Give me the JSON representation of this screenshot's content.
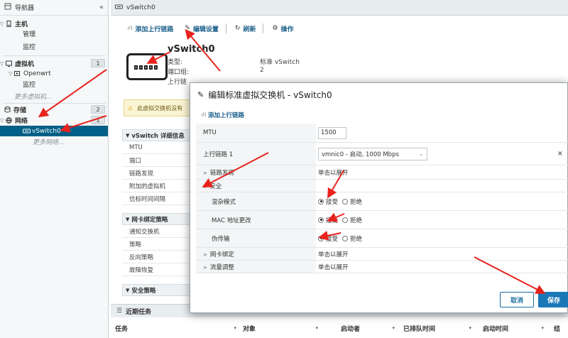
{
  "navigator": {
    "title": "导航器",
    "host": {
      "label": "主机",
      "children": [
        "管理",
        "监控"
      ]
    },
    "vms": {
      "label": "虚拟机",
      "badge": "1",
      "vm": "Openwrt",
      "vm_child": "监控",
      "more": "更多虚拟机..."
    },
    "storage": {
      "label": "存储",
      "badge": "2"
    },
    "network": {
      "label": "网络",
      "badge": "1",
      "selected": "vSwitch0",
      "more": "更多网络..."
    }
  },
  "main": {
    "window_title": "vSwitch0",
    "toolbar": {
      "add_uplink": "添加上行链路",
      "edit": "编辑设置",
      "refresh": "刷新",
      "actions": "操作"
    },
    "switch_name": "vSwitch0",
    "props": [
      {
        "k": "类型:",
        "v": "标准 vSwitch"
      },
      {
        "k": "端口组:",
        "v": "2"
      },
      {
        "k": "上行链",
        "v": ""
      }
    ],
    "warning": "此虚拟交换机没有",
    "details": {
      "title": "vSwitch 详细信息",
      "rows": [
        "MTU",
        "端口",
        "链路发现",
        "附加的虚拟机",
        "信标时间间隔"
      ]
    },
    "nic_teaming": {
      "title": "网卡绑定策略",
      "rows": [
        "通知交换机",
        "策略",
        "反向策略",
        "故障恢复"
      ]
    },
    "security_policy": {
      "title": "安全策略"
    },
    "tasks": {
      "title": "近期任务",
      "columns": [
        "任务",
        "对象",
        "启动者",
        "已排队时间",
        "启动时间",
        "结"
      ]
    }
  },
  "dialog": {
    "title": "编辑标准虚拟交换机 - vSwitch0",
    "add_uplink": "添加上行链路",
    "mtu_label": "MTU",
    "mtu_value": "1500",
    "uplink_label": "上行链路 1",
    "uplink_value": "vmnic0 - 启动, 1000 Mbps",
    "link_discovery_label": "链路发现",
    "expand_hint": "单击以展开",
    "security_label": "安全",
    "promiscuous_label": "混杂模式",
    "mac_change_label": "MAC 地址更改",
    "forged_label": "伪传输",
    "accept": "接受",
    "reject": "拒绝",
    "nic_teaming_label": "网卡绑定",
    "traffic_shaping_label": "流量调整",
    "cancel": "取消",
    "save": "保存",
    "close_glyph": "×"
  },
  "colors": {
    "selected_nav": "#005f86",
    "primary_button": "#1a78b8",
    "annotation_arrow": "#e8231d"
  },
  "icons": [
    "navigator-icon",
    "host-icon",
    "vm-icon",
    "storage-icon",
    "network-icon",
    "switch-icon",
    "pencil-icon",
    "refresh-icon",
    "gear-icon",
    "warning-icon",
    "tasks-icon",
    "uplink-icon"
  ]
}
